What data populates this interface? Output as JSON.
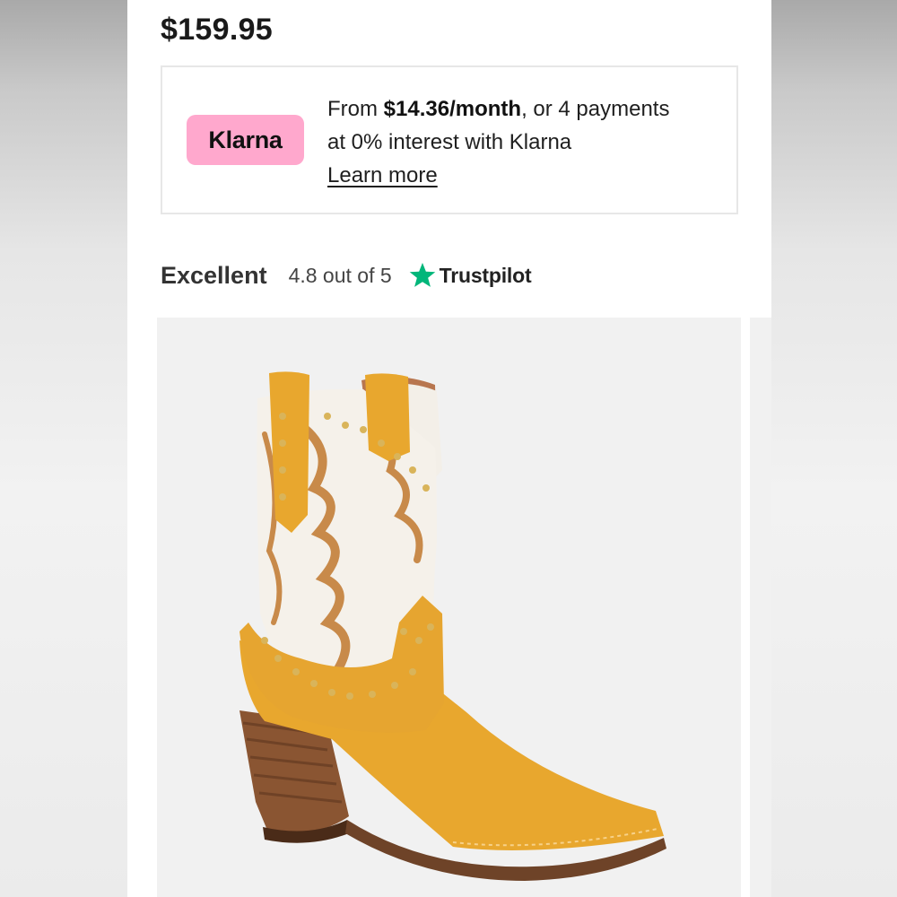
{
  "product": {
    "price": "$159.95"
  },
  "klarna": {
    "badge_label": "Klarna",
    "text_prefix": "From ",
    "monthly_amount": "$14.36/month",
    "text_line1_suffix": ", or 4 payments",
    "text_line2": "at 0% interest with Klarna",
    "learn_more": "Learn more",
    "badge_color": "#ffa8cd"
  },
  "rating": {
    "label": "Excellent",
    "score_text": "4.8 out of 5",
    "provider": "Trustpilot",
    "star_icon": "star-icon",
    "star_color": "#00b67a"
  },
  "gallery": {
    "main_image": "yellow suede and white western ankle boot",
    "image_count_visible": 2
  }
}
